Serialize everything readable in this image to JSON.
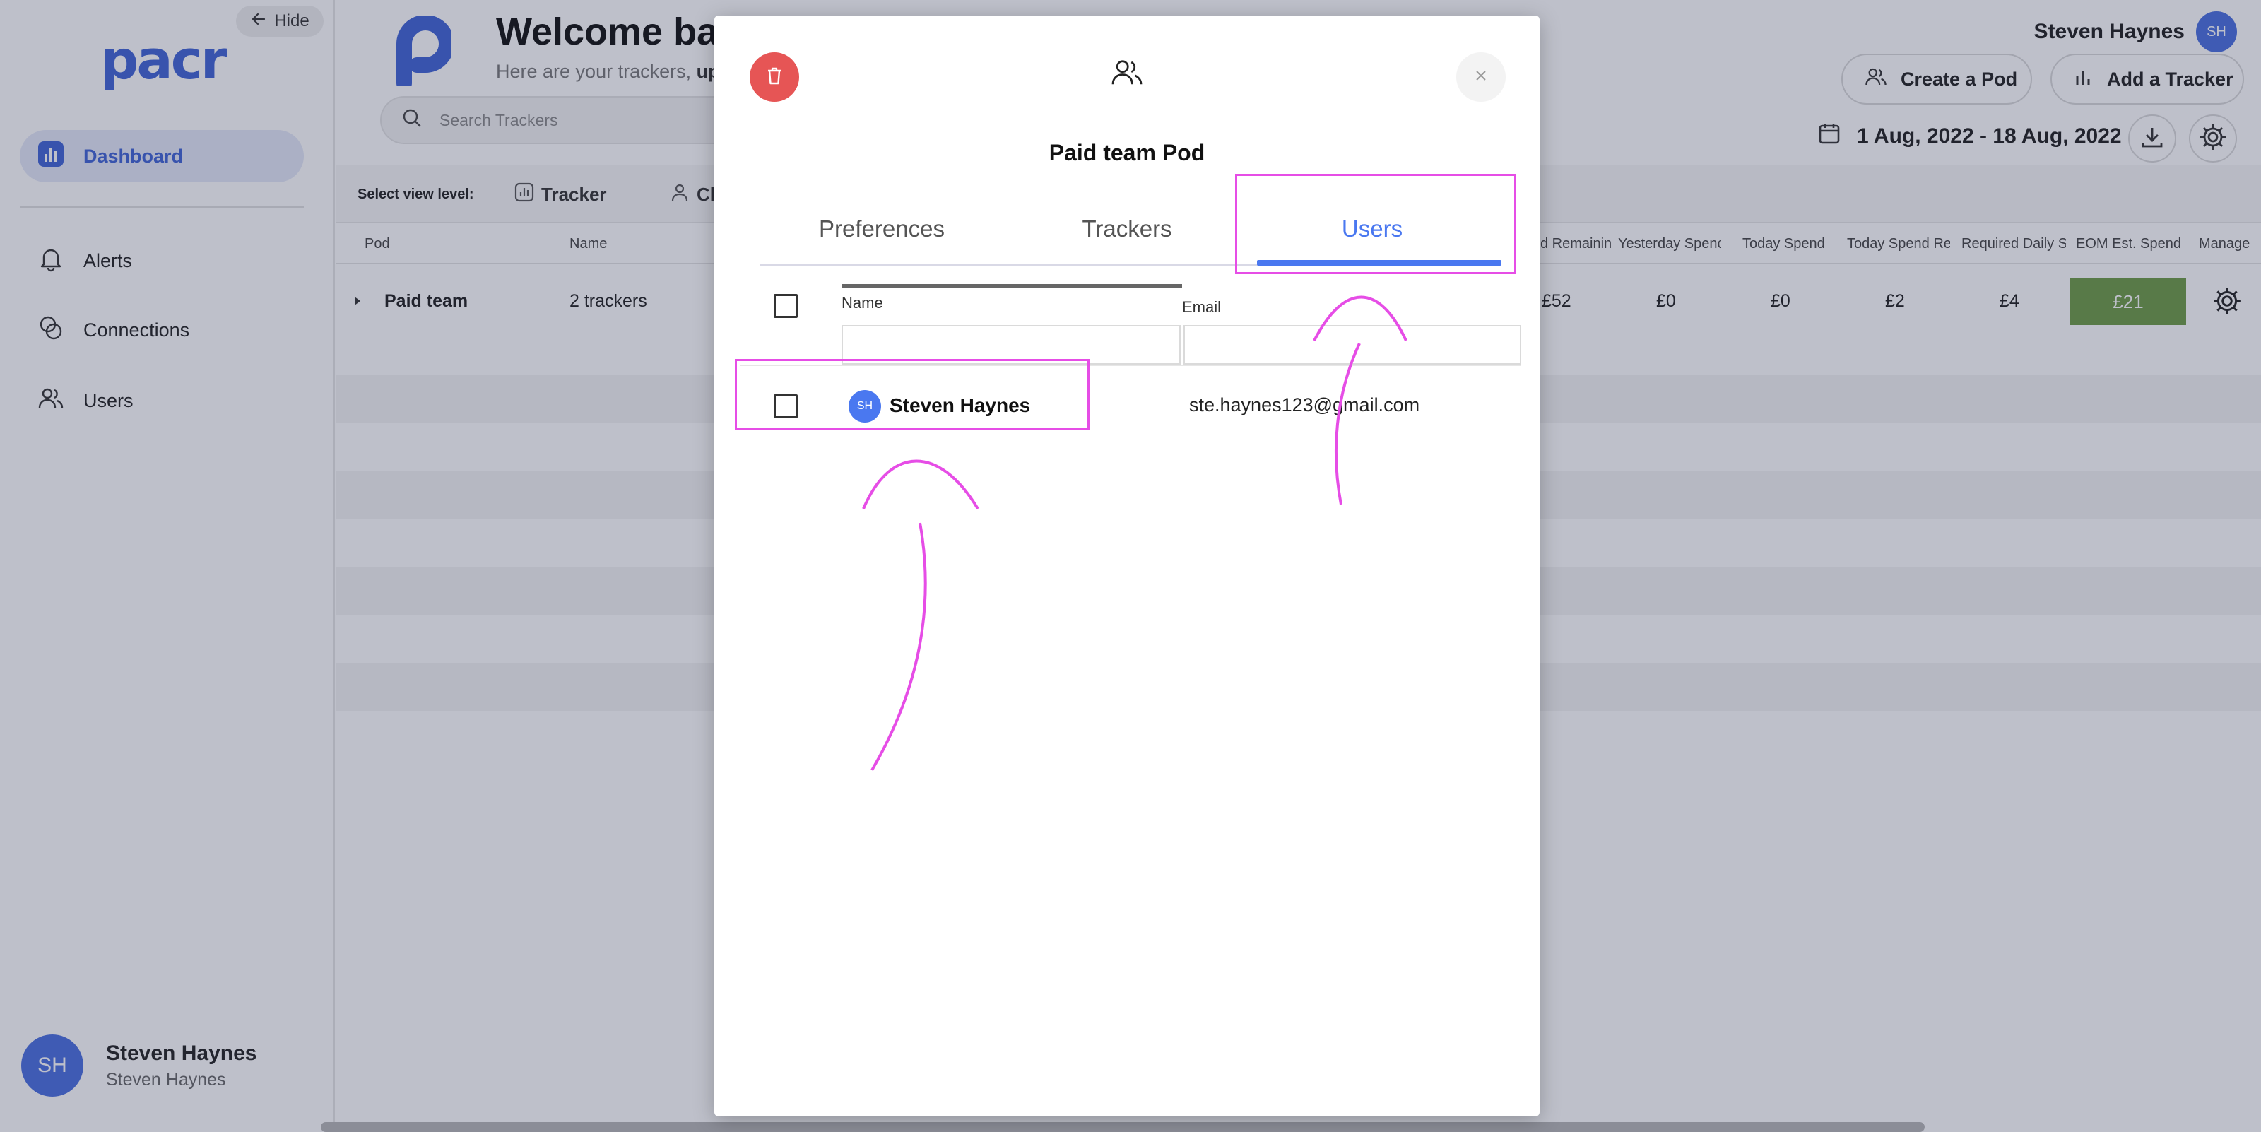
{
  "sidebar": {
    "hide_label": "Hide",
    "logo": "pacr",
    "nav": [
      {
        "label": "Dashboard",
        "icon": "chart-square-icon",
        "active": true
      },
      {
        "label": "Alerts",
        "icon": "bell-icon"
      },
      {
        "label": "Connections",
        "icon": "connections-icon"
      },
      {
        "label": "Users",
        "icon": "users-icon"
      }
    ],
    "user": {
      "initials": "SH",
      "name": "Steven Haynes",
      "sub": "Steven Haynes"
    }
  },
  "header": {
    "welcome": "Welcome bac",
    "subtitle_prefix": "Here are your trackers, ",
    "subtitle_bold": "up",
    "search_placeholder": "Search Trackers",
    "user_name": "Steven Haynes",
    "user_initials": "SH",
    "create_pod": "Create a Pod",
    "add_tracker": "Add a Tracker",
    "date_range": "1 Aug, 2022 - 18 Aug, 2022"
  },
  "view_bar": {
    "label": "Select view level:",
    "options": [
      "Tracker",
      "Cl"
    ]
  },
  "table": {
    "columns": [
      "Pod",
      "Name",
      "d Remainin",
      "Yesterday Spenc",
      "Today Spend",
      "Today Spend Re",
      "Required Daily S",
      "EOM Est. Spend",
      "Manage"
    ],
    "pod_row": {
      "pod": "Paid team",
      "name": "2 trackers",
      "remaining": "£52",
      "yesterday": "£0",
      "today": "£0",
      "today_re": "£2",
      "required": "£4",
      "eom": "£21"
    }
  },
  "modal": {
    "title": "Paid team Pod",
    "tabs": [
      "Preferences",
      "Trackers",
      "Users"
    ],
    "active_tab": "Users",
    "grid": {
      "name_header": "Name",
      "email_header": "Email",
      "rows": [
        {
          "initials": "SH",
          "name": "Steven Haynes",
          "email": "ste.haynes123@gmail.com"
        }
      ]
    }
  },
  "colors": {
    "accent": "#4a78f0",
    "brand": "#3f64d6",
    "delete": "#e65555",
    "eom_cell": "#6e9b45",
    "annotation": "#e64de6"
  }
}
